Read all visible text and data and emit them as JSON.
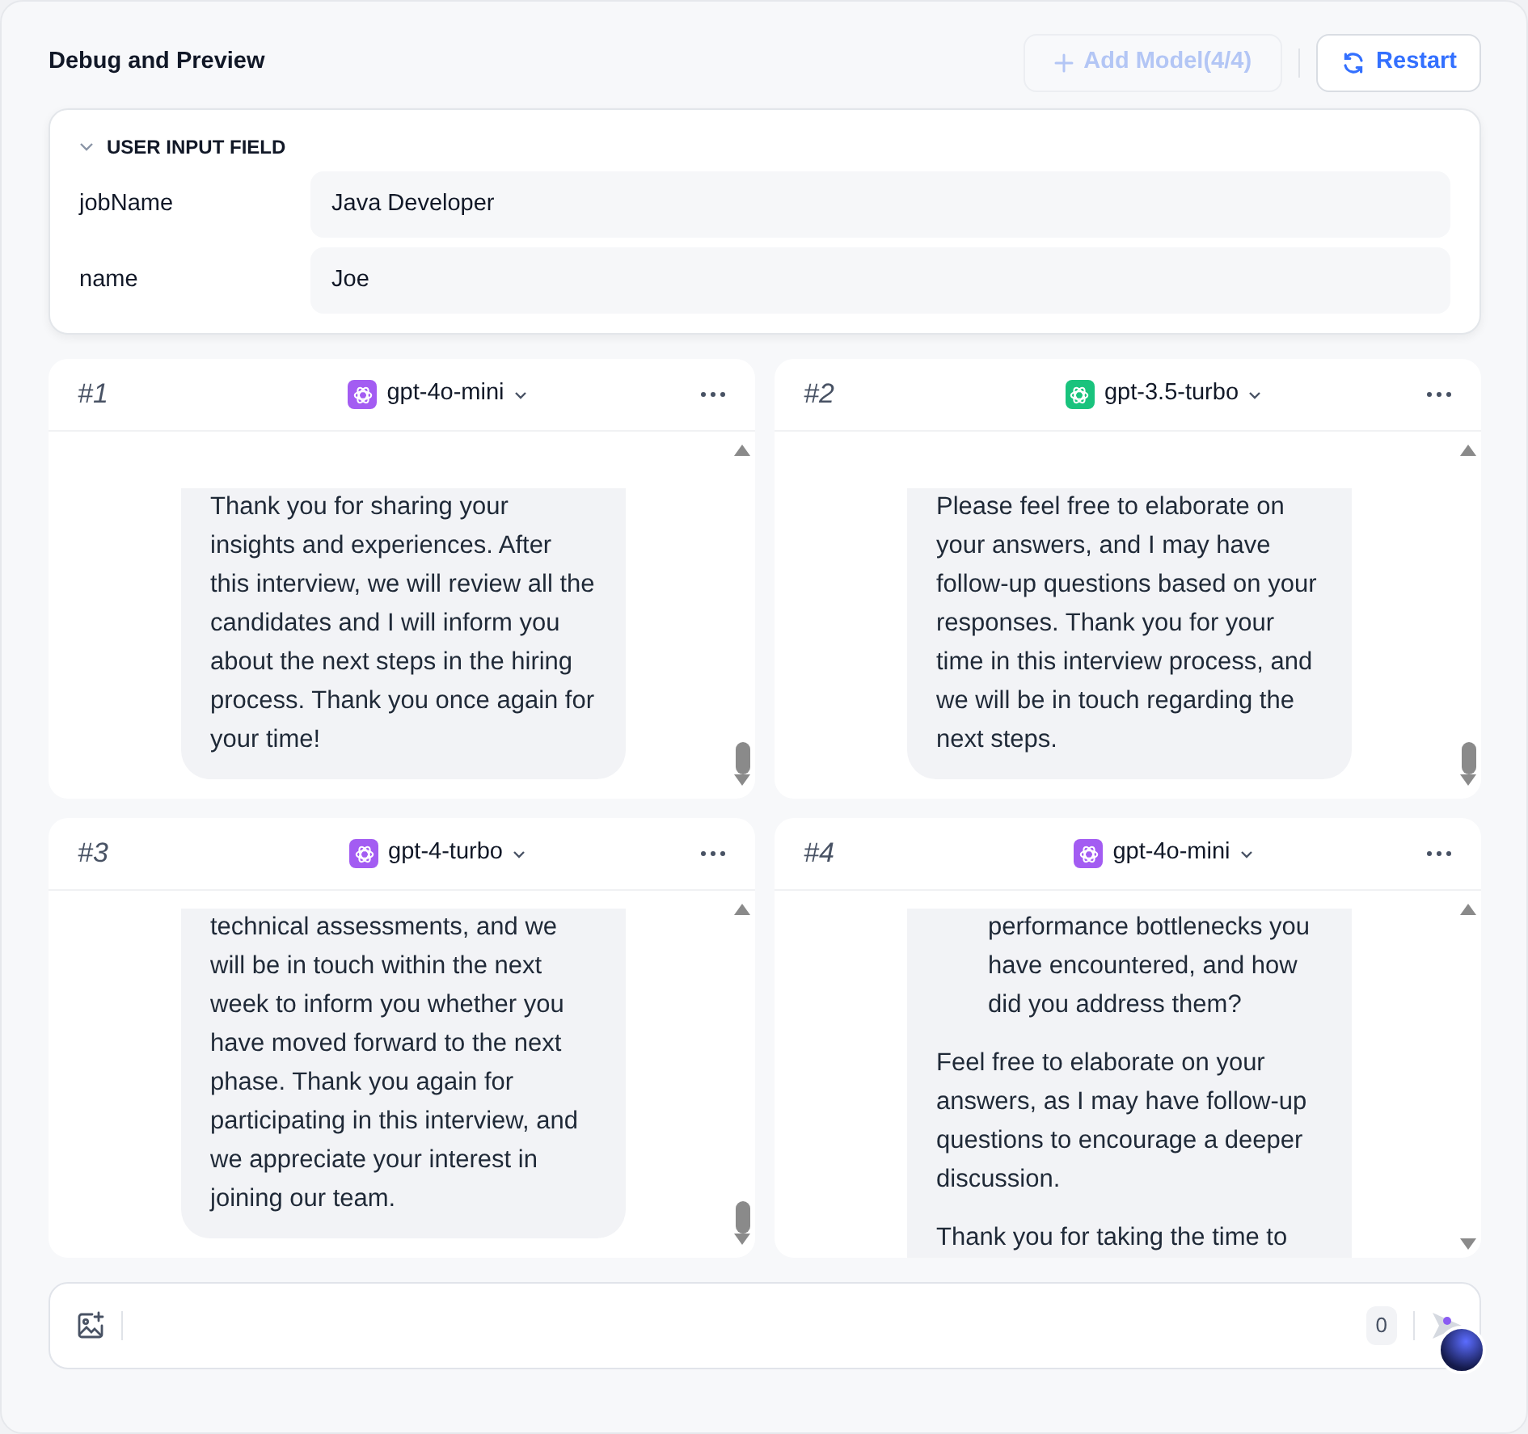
{
  "header": {
    "title": "Debug and Preview",
    "add_model_button": {
      "label": "Add Model(4/4)",
      "disabled": true
    },
    "restart_button": {
      "label": "Restart"
    }
  },
  "user_input": {
    "title": "USER INPUT FIELD",
    "expanded": true,
    "fields": [
      {
        "label": "jobName",
        "value": "Java Developer"
      },
      {
        "label": "name",
        "value": "Joe"
      }
    ]
  },
  "models": [
    {
      "number": "#1",
      "model": "gpt-4o-mini",
      "color": "#a35cf2",
      "messages": [
        {
          "kind": "para",
          "text": "Thank you for sharing your insights and experiences. After this interview, we will review all the candidates and I will inform you about the next steps in the hiring process. Thank you once again for your time!"
        }
      ]
    },
    {
      "number": "#2",
      "model": "gpt-3.5-turbo",
      "color": "#19c37d",
      "messages": [
        {
          "kind": "para",
          "text": "Please feel free to elaborate on your answers, and I may have follow-up questions based on your responses. Thank you for your time in this interview process, and we will be in touch regarding the next steps."
        }
      ]
    },
    {
      "number": "#3",
      "model": "gpt-4-turbo",
      "color": "#a35cf2",
      "messages": [
        {
          "kind": "para",
          "text": "technical assessments, and we will be in touch within the next week to inform you whether you have moved forward to the next phase. Thank you again for participating in this interview, and we appreciate your interest in joining our team."
        }
      ]
    },
    {
      "number": "#4",
      "model": "gpt-4o-mini",
      "color": "#a35cf2",
      "messages": [
        {
          "kind": "indent",
          "text": "performance bottlenecks you have encountered, and how did you address them?"
        },
        {
          "kind": "para",
          "text": "Feel free to elaborate on your answers, as I may have follow-up questions to encourage a deeper discussion."
        },
        {
          "kind": "cut",
          "text": "Thank you for taking the time to"
        }
      ]
    }
  ],
  "chat_input": {
    "counter": "0"
  }
}
